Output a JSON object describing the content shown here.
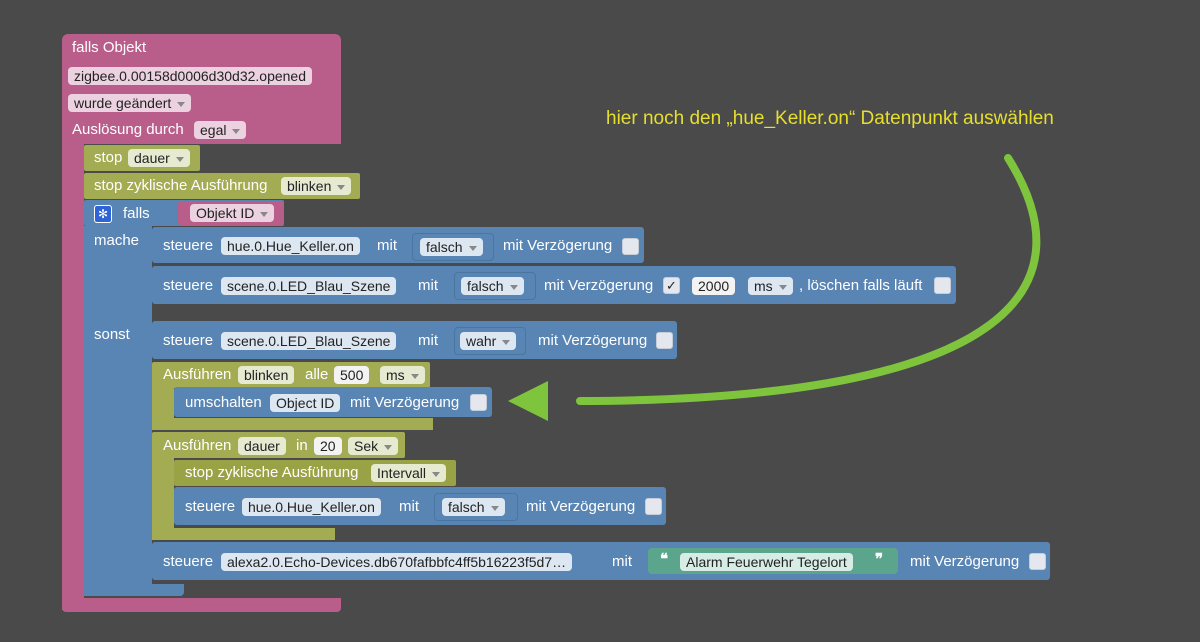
{
  "colors": {
    "background": "#4a4a4a",
    "event_block": "#b95d8a",
    "timer_block": "#a3ac52",
    "control_block": "#5985b4",
    "text_block": "#5ba58c",
    "annotation": "#e6df2c"
  },
  "trigger": {
    "label": "falls Objekt",
    "object_id": "zigbee.0.00158d0006d30d32.opened",
    "condition": "wurde geändert",
    "trigger_by_label": "Auslösung durch",
    "trigger_by_value": "egal"
  },
  "stop1": {
    "label": "stop",
    "value": "dauer"
  },
  "stop2": {
    "label": "stop zyklische Ausführung",
    "value": "blinken"
  },
  "ifblock": {
    "icon": "gear-icon",
    "label": "falls",
    "condition": "Objekt ID",
    "do_label": "mache",
    "else_label": "sonst"
  },
  "ctrl1": {
    "label": "steuere",
    "target": "hue.0.Hue_Keller.on",
    "with": "mit",
    "value": "falsch",
    "delay_label": "mit Verzögerung"
  },
  "ctrl2": {
    "label": "steuere",
    "target": "scene.0.LED_Blau_Szene",
    "with": "mit",
    "value": "falsch",
    "delay_label": "mit Verzögerung",
    "checkmark": "✓",
    "delay_value": "2000",
    "delay_unit": "ms",
    "clear_label": ", löschen falls läuft"
  },
  "ctrl3": {
    "label": "steuere",
    "target": "scene.0.LED_Blau_Szene",
    "with": "mit",
    "value": "wahr",
    "delay_label": "mit Verzögerung"
  },
  "interval": {
    "label": "Ausführen",
    "name": "blinken",
    "every": "alle",
    "value": "500",
    "unit": "ms"
  },
  "toggle": {
    "label": "umschalten",
    "target": "Object ID",
    "delay_label": "mit Verzögerung"
  },
  "timeout": {
    "label": "Ausführen",
    "name": "dauer",
    "in": "in",
    "value": "20",
    "unit": "Sek"
  },
  "stop3": {
    "label": "stop zyklische Ausführung",
    "value": "Intervall"
  },
  "ctrl4": {
    "label": "steuere",
    "target": "hue.0.Hue_Keller.on",
    "with": "mit",
    "value": "falsch",
    "delay_label": "mit Verzögerung"
  },
  "ctrl5": {
    "label": "steuere",
    "target": "alexa2.0.Echo-Devices.db670fafbbfc4ff5b16223f5d7…",
    "with": "mit",
    "quote_open": "❝",
    "text": "Alarm Feuerwehr Tegelort",
    "quote_close": "❞",
    "delay_label": "mit Verzögerung"
  },
  "annotation": {
    "text": "hier noch den „hue_Keller.on“ Datenpunkt auswählen"
  }
}
